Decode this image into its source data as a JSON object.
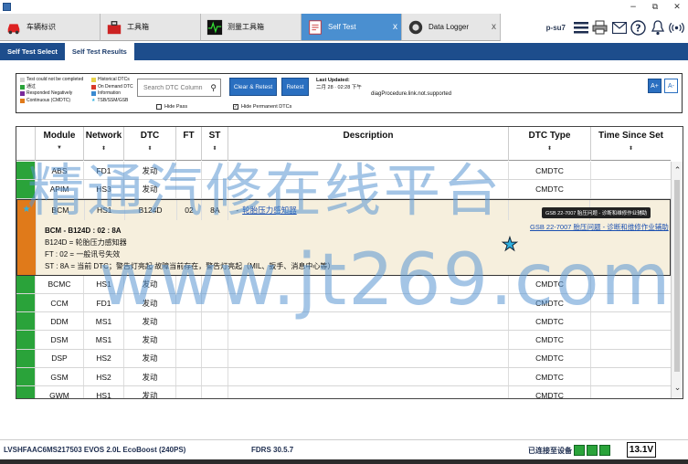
{
  "window": {
    "minimize": "−",
    "restore": "⧉",
    "close": "✕"
  },
  "tabs": [
    {
      "label": "车辆标识",
      "icon": "car-icon"
    },
    {
      "label": "工具箱",
      "icon": "toolbox-icon"
    },
    {
      "label": "测量工具箱",
      "icon": "oscilloscope-icon"
    },
    {
      "label": "Self Test",
      "icon": "selftest-icon",
      "close": "x",
      "active": true
    },
    {
      "label": "Data Logger",
      "icon": "datalogger-icon",
      "close": "x"
    }
  ],
  "header_right": {
    "user": "p-su7"
  },
  "subtabs": [
    "Self Test Select",
    "Self Test Results"
  ],
  "legend": [
    {
      "label": "Test could not be completed",
      "color": "#d0d0d0"
    },
    {
      "label": "Historical DTCs",
      "color": "#e8d24a"
    },
    {
      "label": "通过",
      "color": "#2aa33a"
    },
    {
      "label": "On Demand DTC",
      "color": "#d93a2a"
    },
    {
      "label": "Responded Negatively",
      "color": "#7a2a9a"
    },
    {
      "label": "Information",
      "color": "#3a8ad0"
    },
    {
      "label": "Continuous (CMDTC)",
      "color": "#e07a1a"
    },
    {
      "label": "TSB/SSM/GSB",
      "color": "#2fb0e0"
    }
  ],
  "search": {
    "placeholder": "Search DTC Column"
  },
  "buttons": {
    "clear_retest": "Clear & Retest",
    "retest": "Retest",
    "font_larger": "A+",
    "font_smaller": "A-"
  },
  "checkboxes": {
    "hide_pass": "Hide Pass",
    "hide_permanent": "Hide Permanent DTCs"
  },
  "last_updated": {
    "label": "Last Updated:",
    "value": "二月 28 · 02:28 下午"
  },
  "diag_procedure": "diagProcedure.link.not.supported",
  "table": {
    "headers": [
      "Module",
      "Network",
      "DTC",
      "FT",
      "ST",
      "Description",
      "DTC Type",
      "Time Since Set"
    ],
    "rows_before": [
      {
        "module": "ABS",
        "network": "FD1",
        "dtc": "发动",
        "type": "CMDTC"
      },
      {
        "module": "APIM",
        "network": "HS3",
        "dtc": "发动",
        "type": "CMDTC"
      }
    ],
    "expanded": {
      "module": "BCM",
      "network": "HS1",
      "dtc": "B124D",
      "ft": "02",
      "st": "8A",
      "description": "轮胎压力感知器",
      "tooltip": "GSB 22-7007 胎压问题 - 诊断和维修作业辅助",
      "gsb_link": "GSB 22-7007 胎压问题 - 诊断和维修作业辅助",
      "detail_title": "BCM - B124D : 02 : 8A",
      "detail_1": "B124D = 轮胎压力感知器",
      "detail_2": "FT : 02 = 一般讯号失效",
      "detail_3": "ST : 8A = 当前 DTC；警告灯亮起 故障当前存在，警告灯亮起（MIL、扳手、消息中心等）"
    },
    "rows_after": [
      {
        "module": "BCMC",
        "network": "HS1",
        "dtc": "发动",
        "type": "CMDTC"
      },
      {
        "module": "CCM",
        "network": "FD1",
        "dtc": "发动",
        "type": "CMDTC"
      },
      {
        "module": "DDM",
        "network": "MS1",
        "dtc": "发动",
        "type": "CMDTC"
      },
      {
        "module": "DSM",
        "network": "MS1",
        "dtc": "发动",
        "type": "CMDTC"
      },
      {
        "module": "DSP",
        "network": "HS2",
        "dtc": "发动",
        "type": "CMDTC"
      },
      {
        "module": "GSM",
        "network": "HS2",
        "dtc": "发动",
        "type": "CMDTC"
      },
      {
        "module": "GWM",
        "network": "HS1",
        "dtc": "发动",
        "type": "CMDTC"
      }
    ]
  },
  "watermark": {
    "line1": "精通汽修在线平台",
    "line2": "www.jt269.com"
  },
  "status": {
    "vehicle": "LVSHFAAC6MS217503  EVOS 2.0L EcoBoost (240PS)",
    "fdrs": "FDRS 30.5.7",
    "connected": "已连接至设备",
    "voltage": "13.1V"
  }
}
